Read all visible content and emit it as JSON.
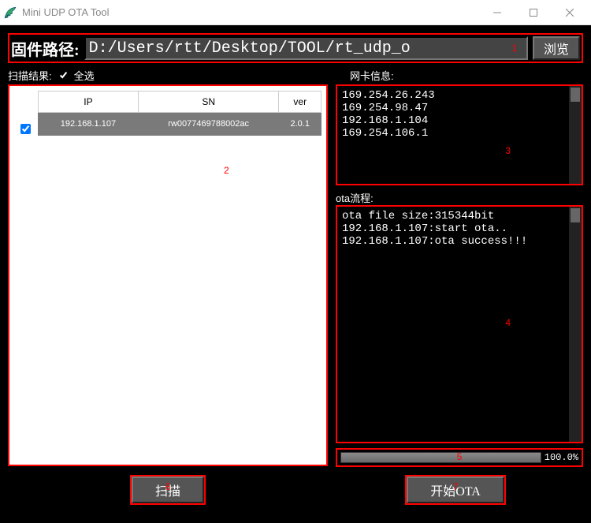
{
  "window": {
    "title": "Mini UDP OTA Tool"
  },
  "firmware": {
    "label": "固件路径:",
    "path": "D:/Users/rtt/Desktop/TOOL/rt_udp_o",
    "browse": "浏览"
  },
  "scan": {
    "result_label": "扫描结果:",
    "select_all_label": "全选",
    "columns": {
      "ip": "IP",
      "sn": "SN",
      "ver": "ver"
    },
    "rows": [
      {
        "checked": true,
        "ip": "192.168.1.107",
        "sn": "rw0077469788002ac",
        "ver": "2.0.1"
      }
    ],
    "scan_button": "扫描"
  },
  "nic": {
    "label": "网卡信息:",
    "entries": [
      "169.254.26.243",
      "169.254.98.47",
      "192.168.1.104",
      "169.254.106.1"
    ]
  },
  "ota": {
    "label": "ota流程:",
    "log": [
      "ota file size:315344bit",
      "192.168.1.107:start ota..",
      "192.168.1.107:ota success!!!"
    ],
    "start_button": "开始OTA"
  },
  "progress": {
    "percent": 100.0,
    "text": "100.0%"
  },
  "annotations": {
    "a1": "1",
    "a2": "2",
    "a3": "3",
    "a4": "4",
    "a5": "5",
    "a6": "6",
    "a7": "7"
  }
}
